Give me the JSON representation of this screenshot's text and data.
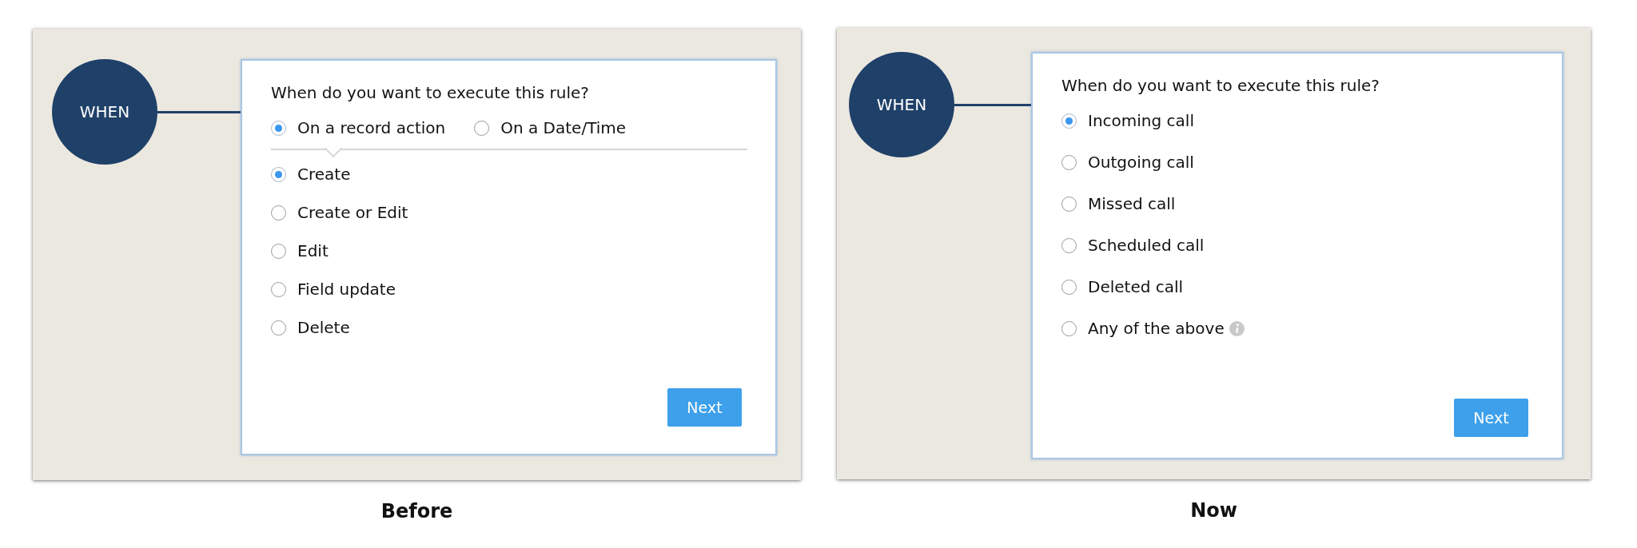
{
  "comparison": [
    {
      "caption": "Before",
      "step_label": "WHEN",
      "question": "When do you want to execute this rule?",
      "modes": [
        {
          "label": "On a record action",
          "selected": true
        },
        {
          "label": "On a Date/Time",
          "selected": false
        }
      ],
      "options": [
        {
          "label": "Create",
          "selected": true
        },
        {
          "label": "Create or Edit",
          "selected": false
        },
        {
          "label": "Edit",
          "selected": false
        },
        {
          "label": "Field update",
          "selected": false
        },
        {
          "label": "Delete",
          "selected": false
        }
      ],
      "button": "Next"
    },
    {
      "caption": "Now",
      "step_label": "WHEN",
      "question": "When do you want to execute this rule?",
      "options": [
        {
          "label": "Incoming call",
          "selected": true,
          "info": false
        },
        {
          "label": "Outgoing call",
          "selected": false,
          "info": false
        },
        {
          "label": "Missed call",
          "selected": false,
          "info": false
        },
        {
          "label": "Scheduled call",
          "selected": false,
          "info": false
        },
        {
          "label": "Deleted call",
          "selected": false,
          "info": false
        },
        {
          "label": "Any of the above",
          "selected": false,
          "info": true
        }
      ],
      "button": "Next"
    }
  ]
}
